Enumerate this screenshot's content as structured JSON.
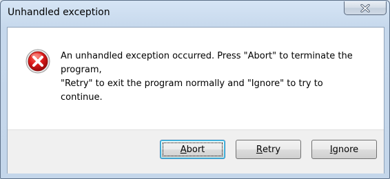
{
  "window": {
    "title": "Unhandled exception",
    "close_icon": "close-icon"
  },
  "dialog": {
    "icon": "error-icon",
    "message_lines": [
      "An unhandled exception occurred. Press \"Abort\" to terminate the",
      "program,",
      "\"Retry\" to exit the program normally and \"Ignore\" to try to",
      "continue."
    ]
  },
  "buttons": {
    "abort": {
      "mnemonic": "A",
      "rest": "bort"
    },
    "retry": {
      "mnemonic": "R",
      "rest": "etry"
    },
    "ignore": {
      "mnemonic": "I",
      "rest": "gnore"
    }
  },
  "colors": {
    "error_red": "#c8101a",
    "default_button_border": "#3c7fb1",
    "close_x": "#ffffff"
  }
}
